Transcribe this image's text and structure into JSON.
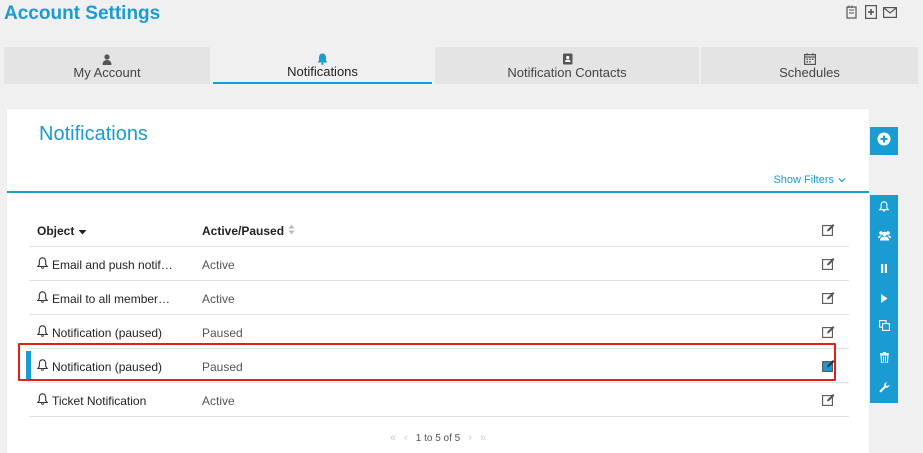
{
  "header": {
    "title": "Account Settings",
    "icons": [
      "notes-icon",
      "add-document-icon",
      "envelope-icon"
    ]
  },
  "tabs": [
    {
      "label": "My Account",
      "icon": "user-icon",
      "active": false
    },
    {
      "label": "Notifications",
      "icon": "bell-icon",
      "active": true
    },
    {
      "label": "Notification Contacts",
      "icon": "address-book-icon",
      "active": false
    },
    {
      "label": "Schedules",
      "icon": "calendar-icon",
      "active": false
    }
  ],
  "panel": {
    "title": "Notifications",
    "show_filters": "Show Filters",
    "columns": {
      "object": "Object",
      "status": "Active/Paused"
    },
    "rows": [
      {
        "object": "Email and push notif…",
        "status": "Active"
      },
      {
        "object": "Email to all member…",
        "status": "Active"
      },
      {
        "object": "Notification (paused)",
        "status": "Paused"
      },
      {
        "object": "Notification (paused)",
        "status": "Paused",
        "selected": true
      },
      {
        "object": "Ticket Notification",
        "status": "Active"
      }
    ],
    "pager": {
      "text": "1 to 5 of 5"
    }
  },
  "colors": {
    "accent": "#1a9bd1",
    "highlight": "#e0201a"
  },
  "side_toolbar": [
    "bell-icon",
    "users-icon",
    "pause-icon",
    "play-icon",
    "copy-icon",
    "trash-icon",
    "wrench-icon"
  ]
}
